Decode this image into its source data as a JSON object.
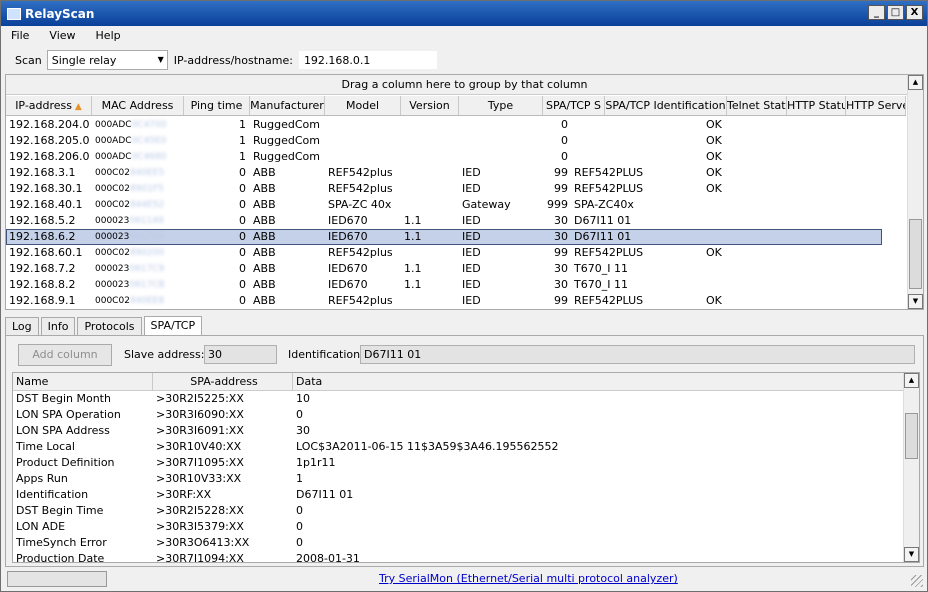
{
  "window": {
    "title": "RelayScan",
    "min": "_",
    "max": "□",
    "close": "X"
  },
  "menu": [
    "File",
    "View",
    "Help"
  ],
  "toolbar": {
    "scan_label": "Scan",
    "scan_mode": "Single relay",
    "ip_label": "IP-address/hostname:",
    "ip_value": "192.168.0.1"
  },
  "grid": {
    "group_hint": "Drag a column here to group by that column",
    "columns": [
      "IP-address",
      "MAC Address",
      "Ping time",
      "Manufacturer",
      "Model",
      "Version",
      "Type",
      "SPA/TCP S",
      "SPA/TCP Identification",
      "Telnet Statu",
      "HTTP Statu",
      "HTTP Serve"
    ],
    "rows": [
      [
        "192.168.204.0",
        "000ADC",
        "0C4700",
        "1",
        "RuggedCom",
        "",
        "",
        "",
        "0",
        "",
        "OK",
        "",
        ""
      ],
      [
        "192.168.205.0",
        "000ADC",
        "0C45E0",
        "1",
        "RuggedCom",
        "",
        "",
        "",
        "0",
        "",
        "OK",
        "",
        ""
      ],
      [
        "192.168.206.0",
        "000ADC",
        "0C4680",
        "1",
        "RuggedCom",
        "",
        "",
        "",
        "0",
        "",
        "OK",
        "",
        ""
      ],
      [
        "192.168.3.1",
        "000C02",
        "840EE5",
        "0",
        "ABB",
        "REF542plus",
        "",
        "IED",
        "99",
        "REF542PLUS",
        "OK",
        "",
        ""
      ],
      [
        "192.168.30.1",
        "000C02",
        "8901F5",
        "0",
        "ABB",
        "REF542plus",
        "",
        "IED",
        "99",
        "REF542PLUS",
        "OK",
        "",
        ""
      ],
      [
        "192.168.40.1",
        "000C02",
        "844E52",
        "0",
        "ABB",
        "SPA-ZC 40x",
        "",
        "Gateway",
        "999",
        "SPA-ZC40x",
        "",
        "",
        ""
      ],
      [
        "192.168.5.2",
        "000023",
        "061149",
        "0",
        "ABB",
        "IED670",
        "1.1",
        "IED",
        "30",
        "D67I11 01",
        "",
        "",
        ""
      ],
      [
        "192.168.6.2",
        "000023",
        "061798",
        "0",
        "ABB",
        "IED670",
        "1.1",
        "IED",
        "30",
        "D67I11 01",
        "",
        "",
        ""
      ],
      [
        "192.168.60.1",
        "000C02",
        "890200",
        "0",
        "ABB",
        "REF542plus",
        "",
        "IED",
        "99",
        "REF542PLUS",
        "OK",
        "",
        ""
      ],
      [
        "192.168.7.2",
        "000023",
        "0617C9",
        "0",
        "ABB",
        "IED670",
        "1.1",
        "IED",
        "30",
        "T670_I 11",
        "",
        "",
        ""
      ],
      [
        "192.168.8.2",
        "000023",
        "0617CB",
        "0",
        "ABB",
        "IED670",
        "1.1",
        "IED",
        "30",
        "T670_I 11",
        "",
        "",
        ""
      ],
      [
        "192.168.9.1",
        "000C02",
        "840EE8",
        "0",
        "ABB",
        "REF542plus",
        "",
        "IED",
        "99",
        "REF542PLUS",
        "OK",
        "",
        ""
      ]
    ]
  },
  "tabs": [
    "Log",
    "Info",
    "Protocols",
    "SPA/TCP"
  ],
  "spa": {
    "add_column": "Add column",
    "slave_label": "Slave address:",
    "slave_value": "30",
    "ident_label": "Identification:",
    "ident_value": "D67I11 01",
    "columns": [
      "Name",
      "SPA-address",
      "Data"
    ],
    "rows": [
      [
        "DST Begin Month",
        ">30R2I5225:XX",
        "10"
      ],
      [
        "LON SPA Operation",
        ">30R3I6090:XX",
        "0"
      ],
      [
        "LON SPA Address",
        ">30R3I6091:XX",
        "30"
      ],
      [
        "Time Local",
        ">30R10V40:XX",
        "LOC$3A2011-06-15 11$3A59$3A46.195562552"
      ],
      [
        "Product Definition",
        ">30R7I1095:XX",
        "1p1r11"
      ],
      [
        "Apps Run",
        ">30R10V33:XX",
        "1"
      ],
      [
        "Identification",
        ">30RF:XX",
        "D67I11 01"
      ],
      [
        "DST Begin Time",
        ">30R2I5228:XX",
        "0"
      ],
      [
        "LON ADE",
        ">30R3I5379:XX",
        "0"
      ],
      [
        "TimeSynch Error",
        ">30R3O6413:XX",
        "0"
      ],
      [
        "Production Date",
        ">30R7I1094:XX",
        "2008-01-31"
      ]
    ]
  },
  "status": {
    "link": "Try SerialMon (Ethernet/Serial multi protocol analyzer)"
  }
}
